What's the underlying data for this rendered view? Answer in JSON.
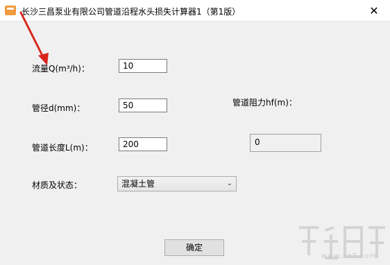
{
  "window": {
    "title": "长沙三昌泵业有限公司管道沿程水头损失计算器1（第1版）",
    "close_glyph": "✕",
    "app_icon": "pump-logo-icon"
  },
  "form": {
    "flow_label": "流量Q(m³/h)：",
    "flow_value": "10",
    "diameter_label": "管径d(mm)：",
    "diameter_value": "50",
    "length_label": "管道长度L(m)：",
    "length_value": "200",
    "material_label": "材质及状态：",
    "material_selected": "混凝土管",
    "resistance_label": "管道阻力hf(m)：",
    "resistance_value": "0",
    "ok_button": "确定"
  },
  "watermark": {
    "text": "www.xz7.com"
  },
  "colors": {
    "arrow": "#d9261c",
    "icon": "#f19a3e"
  }
}
